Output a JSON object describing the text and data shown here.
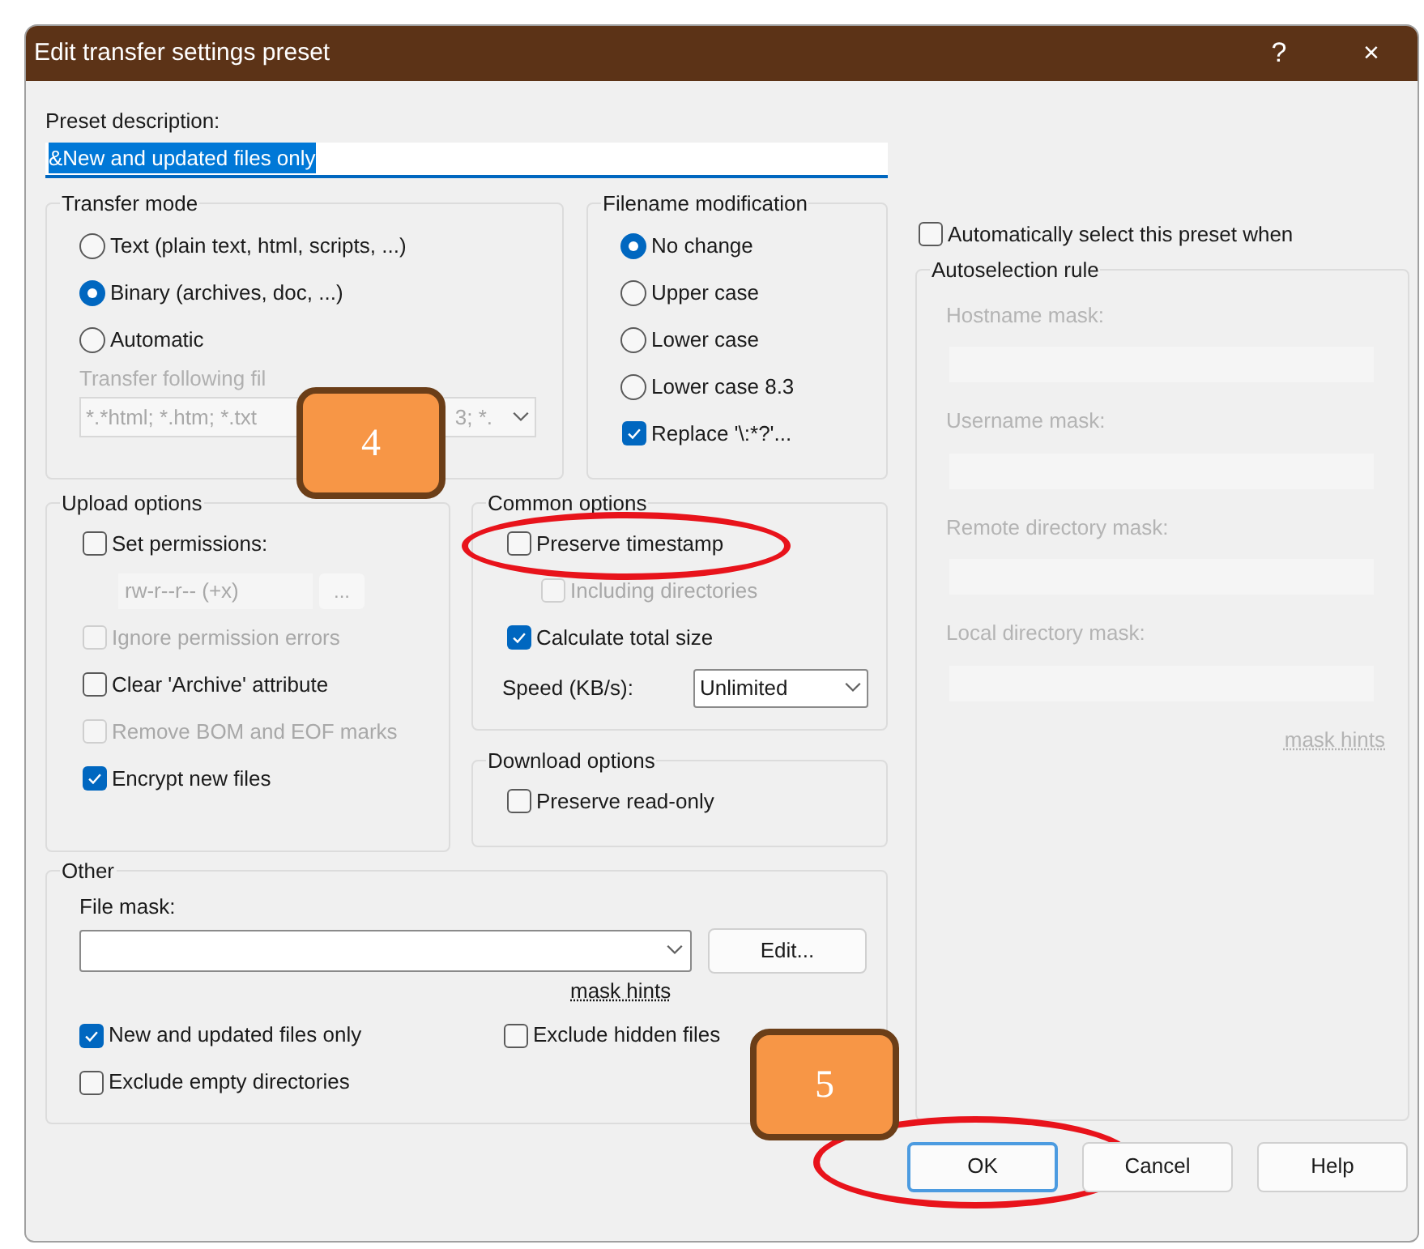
{
  "window": {
    "title": "Edit transfer settings preset",
    "title_buttons": [
      "?",
      "×"
    ]
  },
  "preset_description": {
    "label": "Preset description:",
    "value": "&New and updated files only",
    "selected": true
  },
  "transfer_mode": {
    "title": "Transfer mode",
    "options": [
      {
        "label": "Text (plain text, html, scripts, ...)",
        "selected": false
      },
      {
        "label": "Binary (archives, doc, ...)",
        "selected": true
      },
      {
        "label": "Automatic",
        "selected": false
      }
    ],
    "file_types_label": "Transfer following fil",
    "file_types_value_parts": [
      "*.*html; *.htm; *.txt",
      "3; *."
    ],
    "disabled": true
  },
  "filename_modification": {
    "title": "Filename modification",
    "options": [
      {
        "label": "No change",
        "selected": true
      },
      {
        "label": "Upper case",
        "selected": false
      },
      {
        "label": "Lower case",
        "selected": false
      },
      {
        "label": "Lower case 8.3",
        "selected": false
      }
    ],
    "replace": {
      "label": "Replace '\\:*?'...",
      "checked": true
    }
  },
  "upload_options": {
    "title": "Upload options",
    "items": [
      {
        "kind": "checkbox",
        "label": "Set permissions:",
        "checked": false,
        "disabled": false
      },
      {
        "kind": "permissions",
        "value": "rw-r--r-- (+x)",
        "button": "...",
        "disabled": true
      },
      {
        "kind": "checkbox",
        "label": "Ignore permission errors",
        "checked": false,
        "disabled": true
      },
      {
        "kind": "checkbox",
        "label": "Clear 'Archive' attribute",
        "checked": false,
        "disabled": false
      },
      {
        "kind": "checkbox",
        "label": "Remove BOM and EOF marks",
        "checked": false,
        "disabled": true
      },
      {
        "kind": "checkbox",
        "label": "Encrypt new files",
        "checked": true,
        "disabled": false
      }
    ]
  },
  "common_options": {
    "title": "Common options",
    "items": [
      {
        "kind": "checkbox",
        "label": "Preserve timestamp",
        "checked": false,
        "disabled": false,
        "highlighted": true,
        "children": [
          {
            "kind": "checkbox",
            "label": "Including directories",
            "checked": false,
            "disabled": true,
            "highlighted": false
          }
        ]
      },
      {
        "kind": "checkbox",
        "label": "Calculate total size",
        "checked": true,
        "disabled": false,
        "highlighted": false
      },
      {
        "kind": "dropdown",
        "label": "Speed (KB/s):",
        "value": "Unlimited"
      }
    ]
  },
  "download_options": {
    "title": "Download options",
    "items": [
      {
        "kind": "checkbox",
        "label": "Preserve read-only",
        "checked": false,
        "disabled": false
      }
    ]
  },
  "other": {
    "title": "Other",
    "file_mask_label": "File mask:",
    "edit_button": "Edit...",
    "mask_hints": "mask hints",
    "checkboxes": [
      {
        "label": "New and updated files only",
        "checked": true
      },
      {
        "label": "Exclude hidden files",
        "checked": false
      },
      {
        "label": "Exclude empty directories",
        "checked": false
      }
    ]
  },
  "autoselection": {
    "checkbox": {
      "label": "Automatically select this preset when",
      "checked": false
    },
    "title": "Autoselection rule",
    "disabled": true,
    "fields": [
      {
        "label": "Hostname mask:"
      },
      {
        "label": "Username mask:"
      },
      {
        "label": "Remote directory mask:"
      },
      {
        "label": "Local directory mask:"
      }
    ],
    "mask_hints": "mask hints"
  },
  "buttons": [
    {
      "label": "OK",
      "default": true,
      "highlighted": true
    },
    {
      "label": "Cancel",
      "default": false,
      "highlighted": false
    },
    {
      "label": "Help",
      "default": false,
      "highlighted": false
    }
  ],
  "callouts": [
    {
      "label": "4"
    },
    {
      "label": "5"
    }
  ]
}
